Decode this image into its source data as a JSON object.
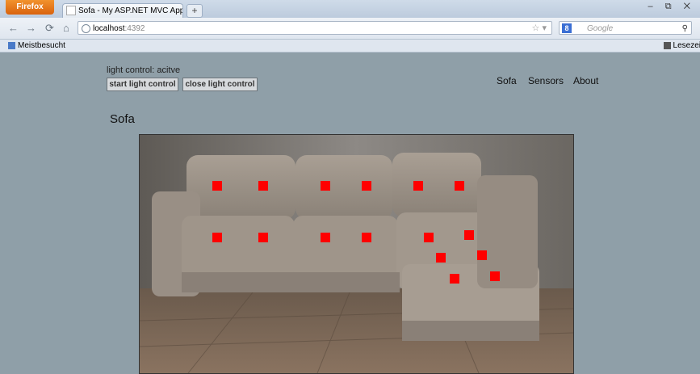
{
  "browser": {
    "firefox_button": "Firefox",
    "tab_title": "Sofa - My ASP.NET MVC Application",
    "new_tab": "+",
    "url_host": "localhost",
    "url_port": ":4392",
    "search_placeholder": "Google",
    "bookmark_left": "Meistbesucht",
    "bookmark_right": "Lesezeic"
  },
  "page": {
    "status": "light control: acitve",
    "start_button": "start light control",
    "close_button": "close light control",
    "nav": [
      "Sofa",
      "Sensors",
      "About"
    ],
    "heading": "Sofa"
  },
  "markers": {
    "count": 16,
    "color": "#ff0000"
  }
}
